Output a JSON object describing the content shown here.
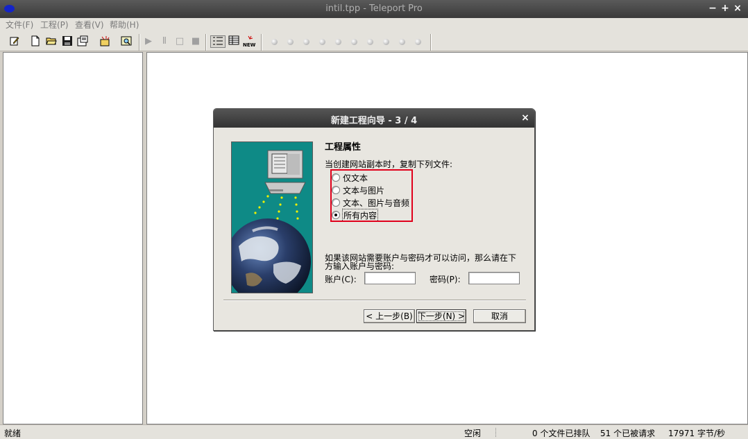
{
  "window": {
    "title": "intil.tpp - Teleport Pro",
    "min": "−",
    "max": "+",
    "close": "×"
  },
  "menu": [
    "文件(F)",
    "工程(P)",
    "查看(V)",
    "帮助(H)"
  ],
  "toolbar": {
    "new_badge": "NEW"
  },
  "dialog": {
    "title": "新建工程向导 - 3 / 4",
    "close": "×",
    "heading": "工程属性",
    "prompt": "当创建网站副本时，复制下列文件:",
    "options": [
      {
        "label": "仅文本",
        "checked": false
      },
      {
        "label": "文本与图片",
        "checked": false
      },
      {
        "label": "文本、图片与音频",
        "checked": false
      },
      {
        "label": "所有内容",
        "checked": true
      }
    ],
    "account_note_line1": "如果该网站需要账户与密码才可以访问，那么请在下",
    "account_note_line2": "方输入账户与密码:",
    "account_label": "账户(C):",
    "password_label": "密码(P):",
    "account_value": "",
    "password_value": "",
    "back_button": "< 上一步(B)",
    "next_button": "下一步(N) >",
    "cancel_button": "取消"
  },
  "status": {
    "ready": "就绪",
    "state": "空闲",
    "queued": "0 个文件已排队",
    "requested": "51 个已被请求",
    "rate": "17971 字节/秒"
  }
}
